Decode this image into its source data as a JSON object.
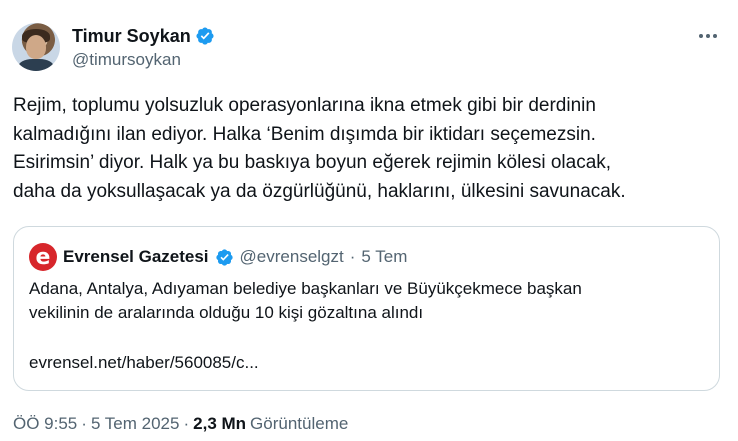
{
  "author": {
    "display_name": "Timur Soykan",
    "handle": "@timursoykan",
    "verified": true
  },
  "tweet": {
    "text": "Rejim, toplumu yolsuzluk operasyonlarına ikna etmek gibi bir derdinin\nkalmadığını ilan ediyor. Halka ‘Benim dışımda bir iktidarı seçemezsin.\nEsirimsin’ diyor. Halk ya bu baskıya boyun eğerek rejimin kölesi olacak,\ndaha da yoksullaşacak ya da özgürlüğünü, haklarını, ülkesini savunacak."
  },
  "quote": {
    "logo_letter": "e",
    "name": "Evrensel Gazetesi",
    "handle": "@evrenselgzt",
    "separator": "·",
    "time": "5 Tem",
    "text": "Adana, Antalya, Adıyaman belediye başkanları ve Büyükçekmece başkan\nvekilinin de aralarında olduğu 10 kişi gözaltına alındı",
    "link": "evrensel.net/haber/560085/c..."
  },
  "meta": {
    "time": "ÖÖ 9:55",
    "sep1": "·",
    "date": "5 Tem 2025",
    "sep2": "·",
    "views_count": "2,3 Mn",
    "views_label": "Görüntüleme"
  },
  "colors": {
    "verified": "#1d9bf0",
    "text_primary": "#0f1419",
    "text_secondary": "#536471",
    "border": "#cfd9de",
    "evrensel_logo": "#d7262b"
  },
  "icons": {
    "verified": "verified-badge-icon",
    "more": "more-dots-icon"
  }
}
